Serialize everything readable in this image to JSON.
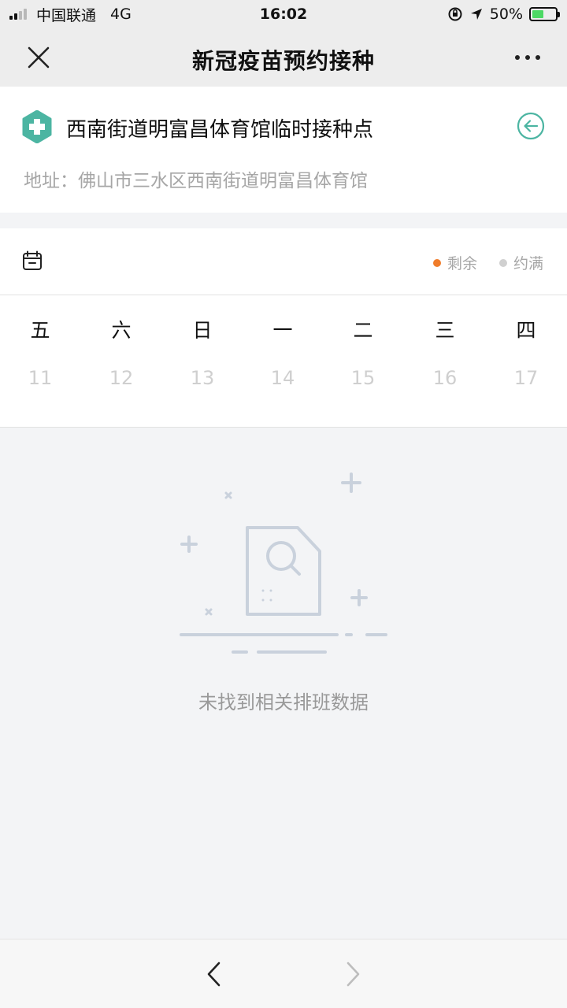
{
  "status_bar": {
    "carrier": "中国联通",
    "network": "4G",
    "time": "16:02",
    "battery_percent": "50%",
    "battery_level": 0.5
  },
  "header": {
    "title": "新冠疫苗预约接种"
  },
  "site": {
    "name": "西南街道明富昌体育馆临时接种点",
    "address": "地址：佛山市三水区西南街道明富昌体育馆",
    "icon": "medical-cross-icon",
    "accent": "#4cb5a2"
  },
  "calendar": {
    "legend": [
      {
        "label": "剩余",
        "color": "#f07c2a"
      },
      {
        "label": "约满",
        "color": "#d0d0d0"
      }
    ],
    "weekdays": [
      "五",
      "六",
      "日",
      "一",
      "二",
      "三",
      "四"
    ],
    "dates": [
      "11",
      "12",
      "13",
      "14",
      "15",
      "16",
      "17"
    ]
  },
  "empty_state": {
    "message": "未找到相关排班数据",
    "icon": "document-search-icon"
  },
  "bottom_nav": {
    "back_icon": "chevron-left-icon",
    "forward_icon": "chevron-right-icon"
  }
}
